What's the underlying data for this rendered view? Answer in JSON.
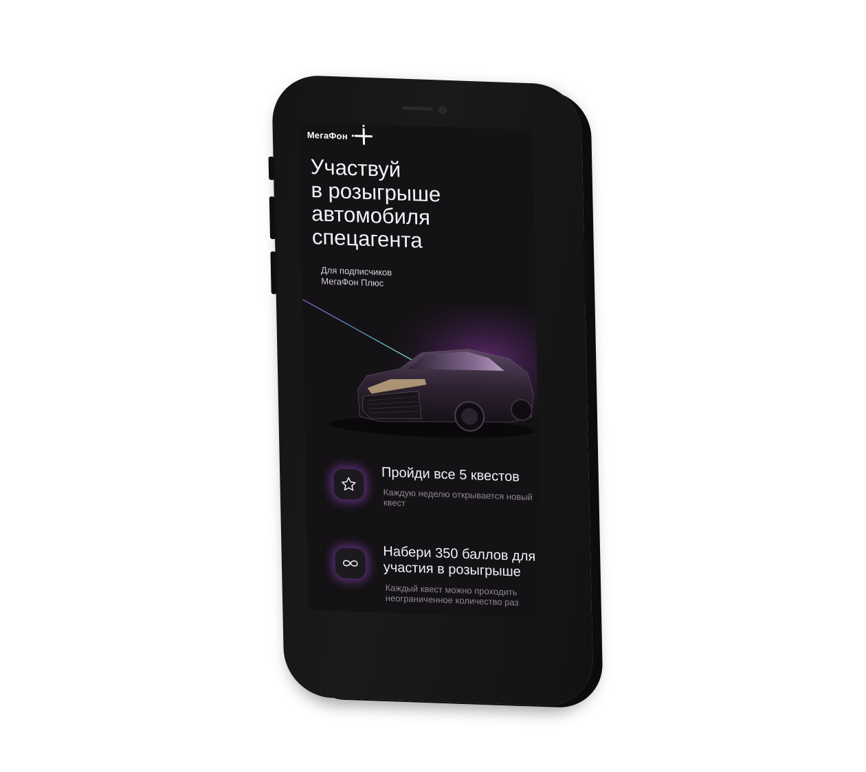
{
  "logo": {
    "text": "МегаФон"
  },
  "promo": {
    "headline": [
      "Участвуй",
      "в розыгрыше",
      "автомобиля",
      "спецагента"
    ],
    "subtitle": [
      "Для подписчиков",
      "МегаФон Плюс"
    ]
  },
  "features": [
    {
      "icon": "star-icon",
      "title": "Пройди все 5 квестов",
      "description": "Каждую неделю открывается новый квест"
    },
    {
      "icon": "infinity-icon",
      "title": "Набери 350 баллов для участия в розыгрыше",
      "description": "Каждый квест можно проходить неограниченное количество раз"
    }
  ],
  "colors": {
    "screen_background": "#141214",
    "phone_body": "#151515",
    "accent_glow": "#9646c8",
    "text_primary": "#f4f2f6",
    "text_secondary": "#8c8790"
  }
}
